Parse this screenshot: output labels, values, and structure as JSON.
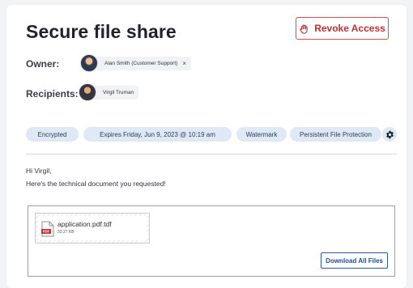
{
  "page": {
    "title": "Secure file share",
    "revoke_label": "Revoke Access"
  },
  "owner": {
    "label": "Owner:",
    "name": "Alan Smith (Customer Support)",
    "remove_symbol": "×"
  },
  "recipients": {
    "label": "Recipients:",
    "items": [
      {
        "name": "Virgil Truman"
      }
    ]
  },
  "tags": [
    {
      "label": "Encrypted"
    },
    {
      "label": "Expires Friday, Jun 9, 2023 @ 10:19 am"
    },
    {
      "label": "Watermark"
    },
    {
      "label": "Persistent File Protection"
    }
  ],
  "message": {
    "greeting": "Hi Virgil,",
    "body": "Here's the technical document you requested!"
  },
  "files": {
    "items": [
      {
        "name": "application.pdf.tdf",
        "size": "33.27 KB",
        "badge": "PDF"
      }
    ],
    "download_all_label": "Download All Files"
  },
  "colors": {
    "accent_red": "#c42f2f",
    "tag_bg": "#dfe8f5",
    "link_blue": "#1f4b9a"
  }
}
